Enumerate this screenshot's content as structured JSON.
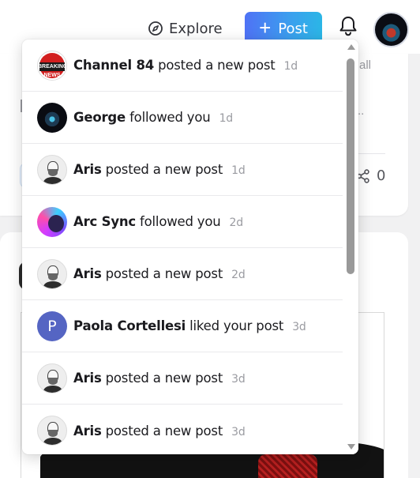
{
  "header": {
    "explore_label": "Explore",
    "post_label": "Post",
    "post_icon": "plus-icon",
    "explore_icon": "compass-icon",
    "notifications_icon": "bell-icon",
    "accent_gradient": [
      "#4f72f5",
      "#2bb6e6"
    ]
  },
  "feed": {
    "card1_hint": "all",
    "card1_ellipsis": "..",
    "share_count": "0"
  },
  "notifications": [
    {
      "name": "Channel 84",
      "action": "posted a new post",
      "time": "1d",
      "avatar": "channel84",
      "avatar_text": "BREAKING NEWS"
    },
    {
      "name": "George",
      "action": "followed you",
      "time": "1d",
      "avatar": "george"
    },
    {
      "name": "Aris",
      "action": "posted a new post",
      "time": "1d",
      "avatar": "aris"
    },
    {
      "name": "Arc Sync",
      "action": "followed you",
      "time": "2d",
      "avatar": "arcsync"
    },
    {
      "name": "Aris",
      "action": "posted a new post",
      "time": "2d",
      "avatar": "aris"
    },
    {
      "name": "Paola Cortellesi",
      "action": "liked your post",
      "time": "3d",
      "avatar": "letter",
      "avatar_letter": "P"
    },
    {
      "name": "Aris",
      "action": "posted a new post",
      "time": "3d",
      "avatar": "aris"
    },
    {
      "name": "Aris",
      "action": "posted a new post",
      "time": "3d",
      "avatar": "aris"
    }
  ]
}
